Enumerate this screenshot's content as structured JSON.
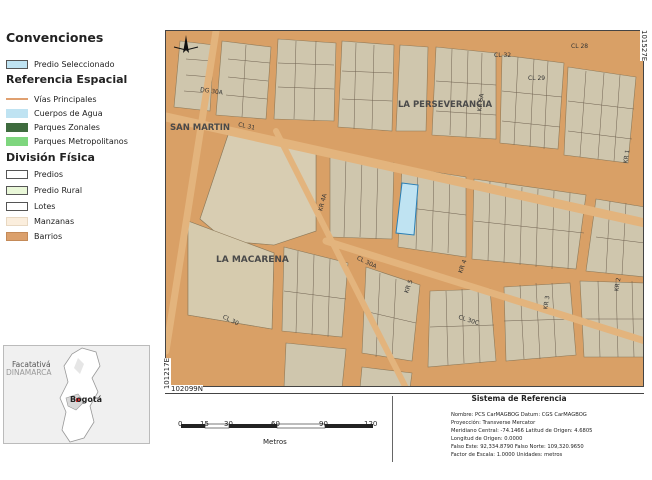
{
  "legend": {
    "title": "Convenciones",
    "selected": "Predio Seleccionado",
    "spatial_ref_title": "Referencia Espacial",
    "spatial_items": [
      {
        "label": "Vías Principales",
        "color": "#e0a070"
      },
      {
        "label": "Cuerpos de Agua",
        "color": "#bfe3f2"
      },
      {
        "label": "Parques Zonales",
        "color": "#3e6b3e"
      },
      {
        "label": "Parques Metropolitanos",
        "color": "#7ed67e"
      }
    ],
    "physical_title": "División Física",
    "physical_items": [
      {
        "label": "Predios",
        "color": "#ffffff"
      },
      {
        "label": "Predio Rural",
        "color": "#e9f7d8"
      },
      {
        "label": "Lotes",
        "color": "#ffffff"
      },
      {
        "label": "Manzanas",
        "color": "#fbeedd"
      },
      {
        "label": "Barrios",
        "color": "#dba06c"
      }
    ]
  },
  "overview": {
    "labels": [
      "Facatativá",
      "DINAMARCA",
      "Bogotá"
    ]
  },
  "map": {
    "neighborhoods": [
      "SAN MARTIN",
      "LA PERSEVERANCIA",
      "LA MACARENA"
    ],
    "streets": [
      "CL 32",
      "CL 31",
      "CL 30A",
      "CL 30",
      "CL 30C",
      "CL 29",
      "CL 28",
      "KR 4",
      "KR 5",
      "KR 4A",
      "KR 3",
      "KR 2",
      "KR 1",
      "DG 30A",
      "KR 5A"
    ],
    "coordinates": {
      "top_right": "101527E",
      "bottom_left": "101217E",
      "bottom_y": "102099N"
    }
  },
  "scale": {
    "ticks": [
      "0",
      "15",
      "30",
      "60",
      "90",
      "120"
    ],
    "unit": "Metros"
  },
  "reference_system": {
    "title": "Sistema de Referencia",
    "lines": [
      "Nombre: PCS CarMAGBOG   Datum: CGS CarMAGBOG",
      "Proyección: Transverse Mercator",
      "Meridiano Central: -74.1466   Latitud de Origen: 4.6805",
      "Longitud de Origen: 0.0000",
      "Falso Este: 92,334.8790   Falso Norte: 109,320.9650",
      "Factor de Escala: 1.0000   Unidades: metros"
    ]
  }
}
